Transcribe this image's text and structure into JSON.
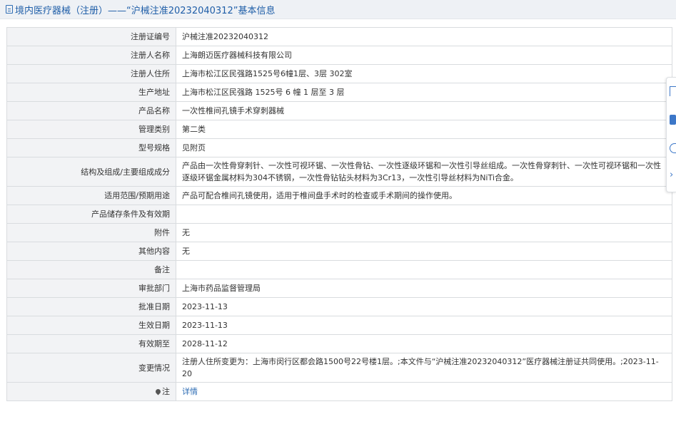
{
  "header": {
    "title": "境内医疗器械（注册）——“沪械注准20232040312”基本信息"
  },
  "rows": [
    {
      "label": "注册证编号",
      "value": "沪械注准20232040312"
    },
    {
      "label": "注册人名称",
      "value": "上海朗迈医疗器械科技有限公司"
    },
    {
      "label": "注册人住所",
      "value": "上海市松江区民强路1525号6幢1层、3层 302室"
    },
    {
      "label": "生产地址",
      "value": "上海市松江区民强路 1525号 6 幢 1 层至 3 层"
    },
    {
      "label": "产品名称",
      "value": "一次性椎间孔镜手术穿刺器械"
    },
    {
      "label": "管理类别",
      "value": "第二类"
    },
    {
      "label": "型号规格",
      "value": "见附页"
    },
    {
      "label": "结构及组成/主要组成成分",
      "value": "产品由一次性骨穿刺针、一次性可视环锯、一次性骨钻、一次性逐级环锯和一次性引导丝组成。一次性骨穿刺针、一次性可视环锯和一次性逐级环锯金属材料为304不锈钢，一次性骨钻钻头材料为3Cr13，一次性引导丝材料为NiTi合金。"
    },
    {
      "label": "适用范围/预期用途",
      "value": "产品可配合椎间孔镜使用，适用于椎间盘手术时的检查或手术期间的操作使用。"
    },
    {
      "label": "产品储存条件及有效期",
      "value": ""
    },
    {
      "label": "附件",
      "value": "无"
    },
    {
      "label": "其他内容",
      "value": "无"
    },
    {
      "label": "备注",
      "value": ""
    },
    {
      "label": "审批部门",
      "value": "上海市药品监督管理局"
    },
    {
      "label": "批准日期",
      "value": "2023-11-13"
    },
    {
      "label": "生效日期",
      "value": "2023-11-13"
    },
    {
      "label": "有效期至",
      "value": "2028-11-12"
    },
    {
      "label": "变更情况",
      "value": "注册人住所变更为：上海市闵行区都会路1500号22号楼1层。;本文件与“沪械注准20232040312”医疗器械注册证共同使用。;2023-11-20"
    }
  ],
  "note": {
    "label": "注",
    "link": "详情",
    "icon": "pin-icon"
  },
  "side_tools": [
    "toolbar-icon-1",
    "toolbar-icon-2",
    "toolbar-icon-3",
    "chevron-right-icon"
  ]
}
